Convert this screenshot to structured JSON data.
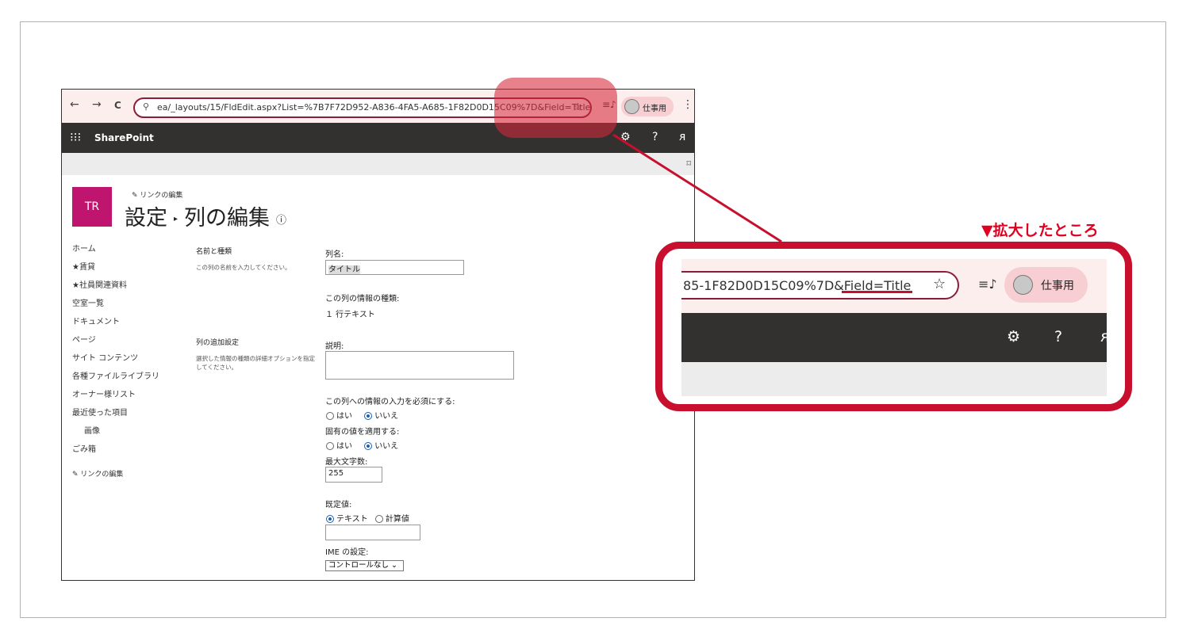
{
  "browser": {
    "back": "←",
    "forward": "→",
    "reload": "C",
    "url": "ea/_layouts/15/FldEdit.aspx?List=%7B7F72D952-A836-4FA5-A685-1F82D0D15C09%7D&Field=Title",
    "profile_label": "仕事用",
    "menu": "⋮"
  },
  "sharepoint": {
    "waffle": "⁝⁝⁝",
    "brand": "SharePoint",
    "settings": "⚙",
    "help": "?",
    "user": "ᴙ"
  },
  "site": {
    "tile": "TR",
    "edit_links": "リンクの編集",
    "title_a": "設定",
    "title_b": "列の編集"
  },
  "leftnav": [
    "ホーム",
    "★賃貸",
    "★社員関連資料",
    "空室一覧",
    "ドキュメント",
    "ページ",
    "サイト コンテンツ",
    "各種ファイルライブラリ",
    "オーナー様リスト",
    "最近使った項目",
    "画像",
    "ごみ箱"
  ],
  "leftnav_edit": "リンクの編集",
  "form": {
    "sec1_title": "名前と種類",
    "sec1_desc": "この列の名前を入力してください。",
    "sec2_title": "列の追加設定",
    "sec2_desc": "選択した情報の種類の詳細オプションを指定してください。",
    "col_name_label": "列名:",
    "col_name_value": "タイトル",
    "info_type_label": "この列の情報の種類:",
    "info_type_value": "１ 行テキスト",
    "desc_label": "説明:",
    "required_label": "この列への情報の入力を必須にする:",
    "yes": "はい",
    "no": "いいえ",
    "unique_label": "固有の値を適用する:",
    "maxlen_label": "最大文字数:",
    "maxlen_value": "255",
    "default_label": "既定値:",
    "text_opt": "テキスト",
    "calc_opt": "計算値",
    "ime_label": "IME の設定:",
    "ime_value": "コントロールなし"
  },
  "zoom": {
    "caption": "▼拡大したところ",
    "url_fragment": "85-1F82D0D15C09%7D&Field=Title",
    "profile_label": "仕事用"
  },
  "colors": {
    "accent": "#c8102e",
    "tile": "#c0156e",
    "suite_bar": "#323130"
  }
}
